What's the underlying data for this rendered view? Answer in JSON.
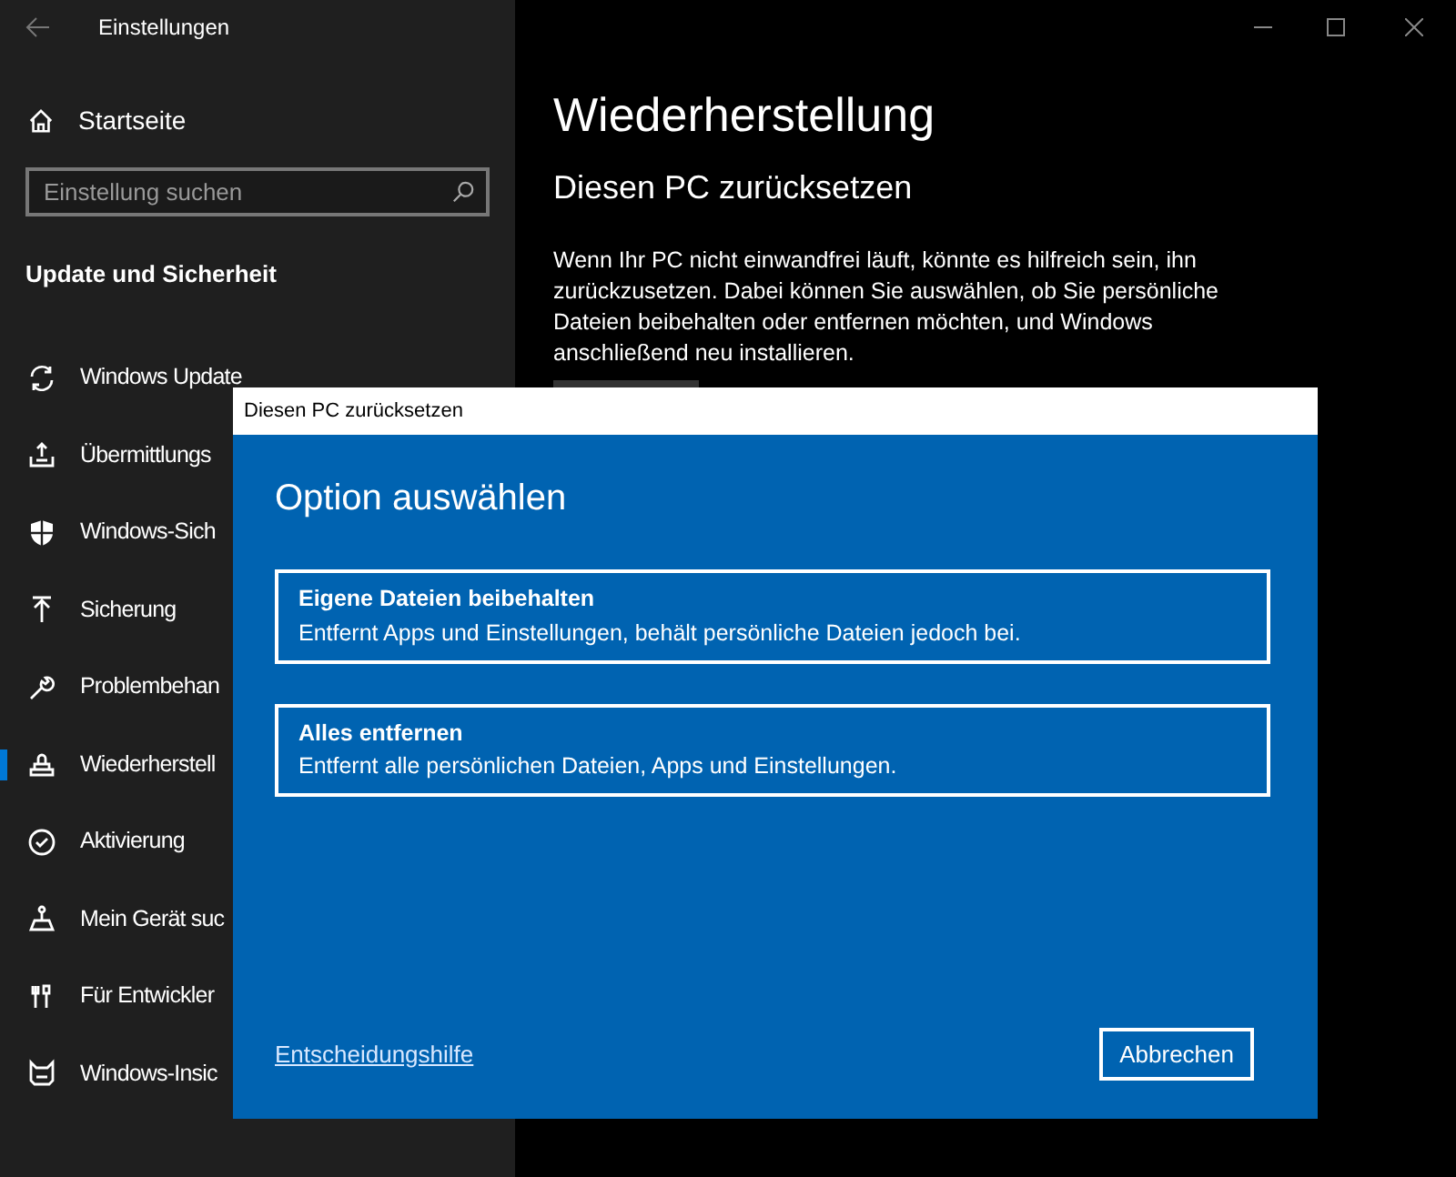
{
  "window": {
    "title": "Einstellungen"
  },
  "sidebar": {
    "home": "Startseite",
    "search": {
      "placeholder": "Einstellung suchen"
    },
    "section": "Update und Sicherheit",
    "items": [
      {
        "kind": "sync",
        "label": "Windows Update",
        "selected": false
      },
      {
        "kind": "delivery",
        "label": "Übermittlungs",
        "selected": false
      },
      {
        "kind": "shield",
        "label": "Windows-Sich",
        "selected": false
      },
      {
        "kind": "backup",
        "label": "Sicherung",
        "selected": false
      },
      {
        "kind": "wrench",
        "label": "Problembehan",
        "selected": false
      },
      {
        "kind": "recovery",
        "label": "Wiederherstell",
        "selected": true
      },
      {
        "kind": "check",
        "label": "Aktivierung",
        "selected": false
      },
      {
        "kind": "find",
        "label": "Mein Gerät suc",
        "selected": false
      },
      {
        "kind": "dev",
        "label": "Für Entwickler",
        "selected": false
      },
      {
        "kind": "insider",
        "label": "Windows-Insic",
        "selected": false
      }
    ]
  },
  "main": {
    "title": "Wiederherstellung",
    "subtitle": "Diesen PC zurücksetzen",
    "description": "Wenn Ihr PC nicht einwandfrei läuft, könnte es hilfreich sein, ihn zurückzusetzen. Dabei können Sie auswählen, ob Sie persönliche Dateien beibehalten oder entfernen möchten, und Windows anschließend neu installieren."
  },
  "dialog": {
    "title": "Diesen PC zurücksetzen",
    "heading": "Option auswählen",
    "options": [
      {
        "title": "Eigene Dateien beibehalten",
        "description": "Entfernt Apps und Einstellungen, behält persönliche Dateien jedoch bei."
      },
      {
        "title": "Alles entfernen",
        "description": "Entfernt alle persönlichen Dateien, Apps und Einstellungen."
      }
    ],
    "help_link": "Entscheidungshilfe",
    "cancel": "Abbrechen"
  }
}
